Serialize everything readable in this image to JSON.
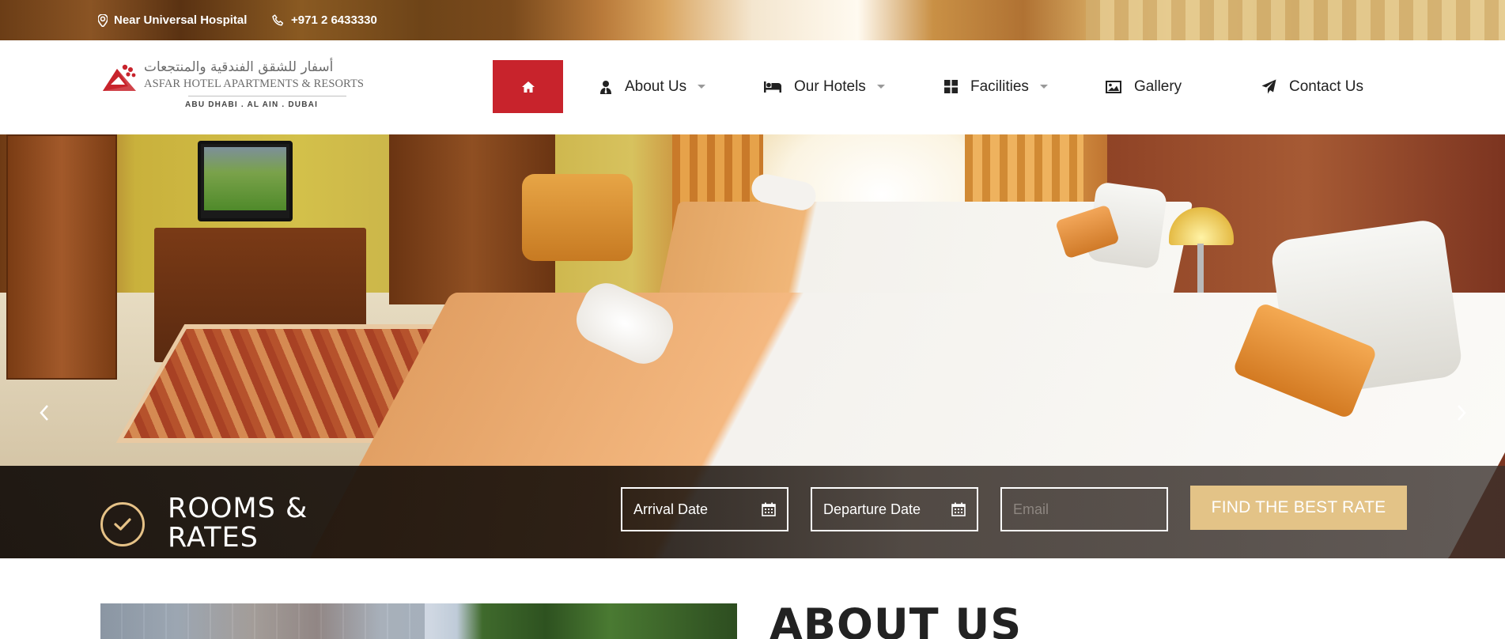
{
  "topbar": {
    "location": "Near Universal Hospital",
    "phone": "+971 2 6433330"
  },
  "logo": {
    "arabic_name": "أسفار للشقق الفندقية والمنتجعات",
    "name": "ASFAR HOTEL APARTMENTS & RESORTS",
    "cities": "ABU DHABI  .  AL AIN  .  DUBAI"
  },
  "nav": {
    "home_icon": "home-icon",
    "items": [
      {
        "label": "About Us",
        "icon": "user-tie-icon",
        "dropdown": true
      },
      {
        "label": "Our Hotels",
        "icon": "bed-icon",
        "dropdown": true
      },
      {
        "label": "Facilities",
        "icon": "grid-icon",
        "dropdown": true
      },
      {
        "label": "Gallery",
        "icon": "image-icon",
        "dropdown": false
      },
      {
        "label": "Contact Us",
        "icon": "paper-plane-icon",
        "dropdown": false
      }
    ]
  },
  "booking": {
    "title": "ROOMS & RATES",
    "arrival_label": "Arrival Date",
    "departure_label": "Departure Date",
    "email_placeholder": "Email",
    "button_label": "FIND THE BEST RATE"
  },
  "about": {
    "title": "ABOUT US"
  },
  "colors": {
    "brand_red": "#c8232c",
    "accent_gold": "#e3c387",
    "text_dark": "#222222"
  }
}
